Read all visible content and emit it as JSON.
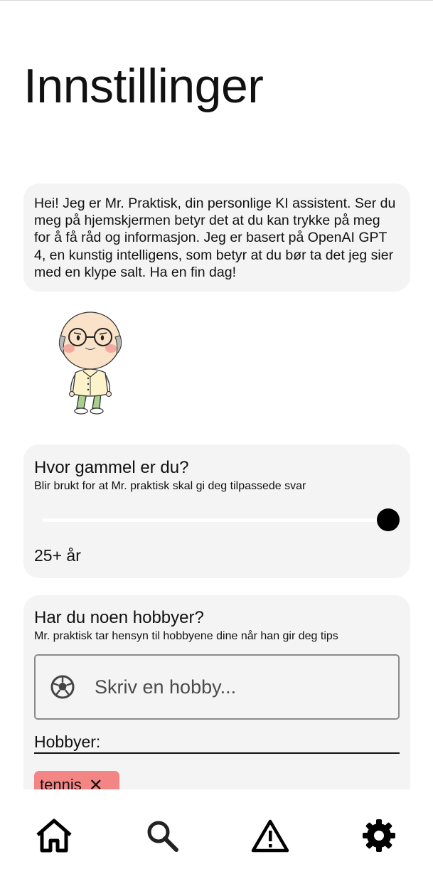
{
  "page": {
    "title": "Innstillinger"
  },
  "intro": {
    "text": "Hei! Jeg er Mr. Praktisk, din personlige KI assistent. Ser du meg på hjemskjermen betyr det at du kan trykke på meg for å få råd og informasjon. Jeg er basert på OpenAI GPT 4, en kunstig intelligens, som betyr at du bør ta det jeg sier med en klype salt. Ha en fin dag!",
    "mascot": "mr-praktisk-avatar"
  },
  "age": {
    "heading": "Hvor gammel er du?",
    "subtitle": "Blir brukt for at Mr. praktisk skal gi deg tilpassede svar",
    "slider_fraction": 1.0,
    "value_label": "25+ år"
  },
  "hobbies": {
    "heading": "Har du noen hobbyer?",
    "subtitle": "Mr. praktisk tar hensyn til hobbyene dine når han gir deg tips",
    "input_placeholder": "Skriv en hobby...",
    "input_icon": "soccer-ball-icon",
    "list_label": "Hobbyer:",
    "items": [
      {
        "label": "tennis",
        "remove_icon": "close-icon",
        "color": "#f48585"
      }
    ]
  },
  "nav": {
    "items": [
      {
        "name": "home",
        "icon": "home-icon"
      },
      {
        "name": "search",
        "icon": "search-icon"
      },
      {
        "name": "warning",
        "icon": "warning-icon"
      },
      {
        "name": "settings",
        "icon": "gear-icon",
        "active": true
      }
    ]
  },
  "colors": {
    "card_bg": "#f4f4f4",
    "chip_bg": "#f48585",
    "slider_thumb": "#000000"
  }
}
